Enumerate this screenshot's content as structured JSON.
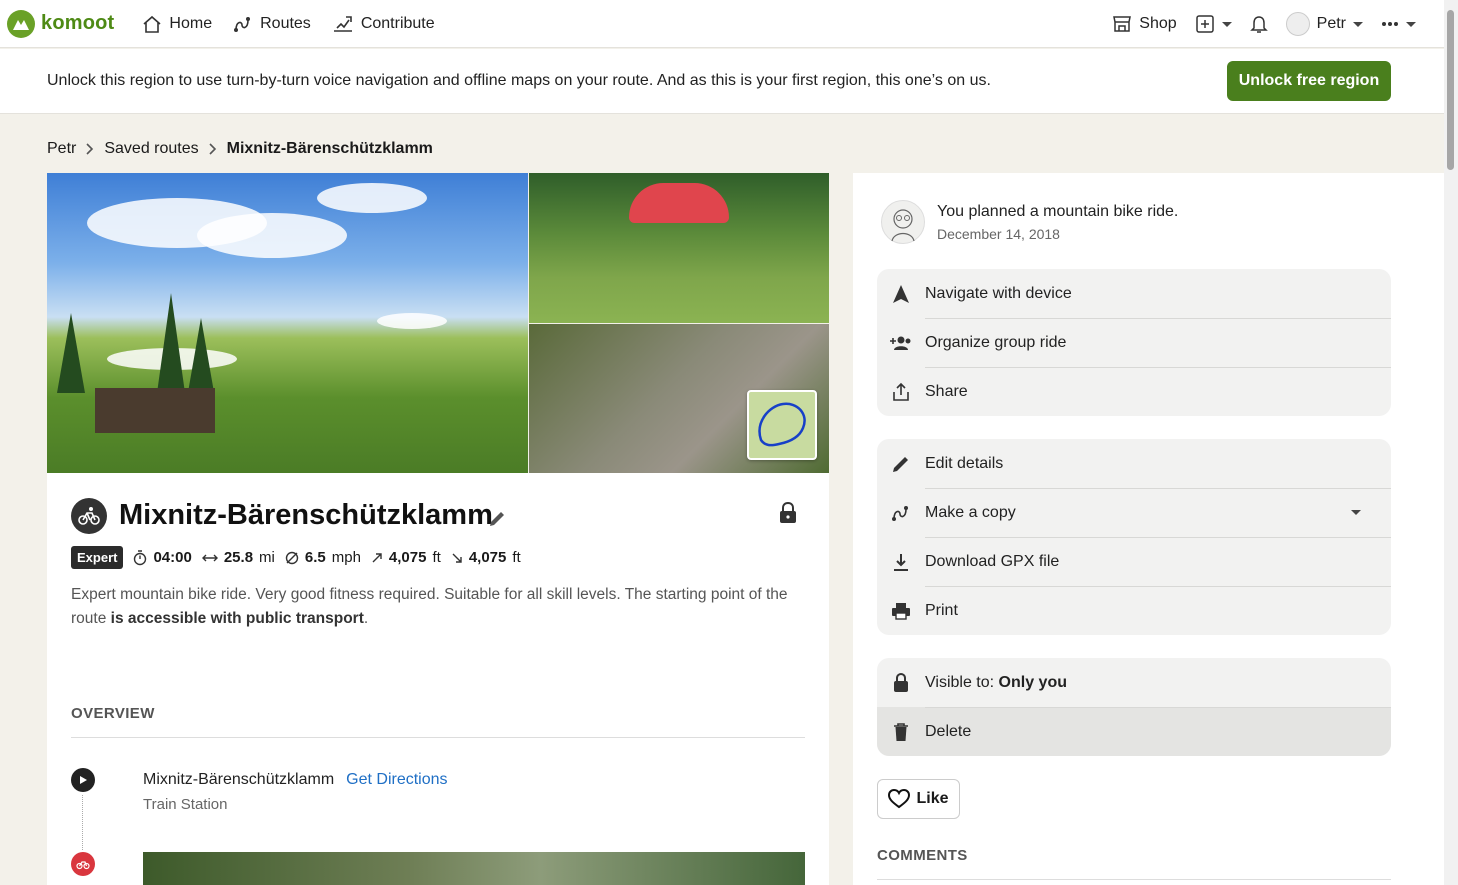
{
  "nav": {
    "logo_text": "komoot",
    "home": "Home",
    "routes": "Routes",
    "contribute": "Contribute",
    "shop": "Shop",
    "user": "Petr"
  },
  "banner": {
    "text": "Unlock this region to use turn-by-turn voice navigation and offline maps on your route. And as this is your first region, this one’s on us.",
    "button": "Unlock free region"
  },
  "breadcrumb": [
    "Petr",
    "Saved routes",
    "Mixnitz-Bärenschützklamm"
  ],
  "tour": {
    "title": "Mixnitz-Bärenschützklamm",
    "difficulty": "Expert",
    "duration": "04:00",
    "distance": "25.8",
    "distance_unit": "mi",
    "speed": "6.5",
    "speed_unit": "mph",
    "uphill": "4,075",
    "downhill": "4,075",
    "elev_unit": "ft",
    "desc_text": "Expert mountain bike ride. Very good fitness required. Suitable for all skill levels. The starting point of the route ",
    "desc_bold": "is accessible with public transport",
    "desc_end": ".",
    "overview_label": "OVERVIEW",
    "start_name": "Mixnitz-Bärenschützklamm",
    "get_directions": "Get Directions",
    "start_sub": "Train Station"
  },
  "panel": {
    "planned": "You planned a mountain bike ride.",
    "date": "December 14, 2018",
    "group1": [
      "Navigate with device",
      "Organize group ride",
      "Share"
    ],
    "group2": [
      "Edit details",
      "Make a copy",
      "Download GPX file",
      "Print"
    ],
    "visible_label": "Visible to:",
    "visible_value": "Only you",
    "delete": "Delete",
    "like": "Like",
    "comments": "COMMENTS"
  },
  "colors": {
    "brand_green": "#4a7f1d",
    "link_blue": "#1f6fc5",
    "waypoint_red": "#d9363e"
  }
}
